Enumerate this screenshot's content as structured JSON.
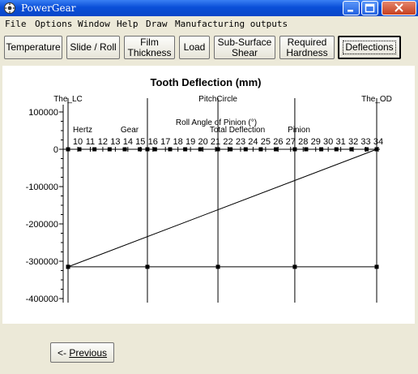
{
  "window": {
    "title": "PowerGear"
  },
  "menu": [
    "File",
    "Options",
    "Window",
    "Help",
    "Draw",
    "Manufacturing outputs"
  ],
  "toolbar": {
    "buttons": [
      {
        "label": "Temperature"
      },
      {
        "label": "Slide / Roll"
      },
      {
        "label": "Film\nThickness"
      },
      {
        "label": "Load"
      },
      {
        "label": "Sub-Surface\nShear"
      },
      {
        "label": "Required\nHardness"
      },
      {
        "label": "Deflections",
        "active": true
      }
    ]
  },
  "chart_data": {
    "type": "line",
    "title": "Tooth Deflection (mm)",
    "xlabel": "Roll Angle of Pinion (°)",
    "ylabel": "",
    "x_ticks": [
      10,
      11,
      12,
      13,
      14,
      15,
      16,
      17,
      18,
      19,
      20,
      21,
      22,
      23,
      24,
      25,
      26,
      27,
      28,
      29,
      30,
      31,
      32,
      33,
      34
    ],
    "y_ticks": [
      100000,
      0,
      -100000,
      -200000,
      -300000,
      -400000
    ],
    "ylim": [
      -400000,
      100000
    ],
    "xlim": [
      9.5,
      34
    ],
    "markers": [
      {
        "label": "The_LC",
        "x": 9.5
      },
      {
        "label": "PitchCircle",
        "x": 21.4
      },
      {
        "label": "The_OD",
        "x": 34
      }
    ],
    "vertical_lines_x": [
      9.5,
      15.8,
      21.4,
      27.5,
      34
    ],
    "legend": [
      "Hertz",
      "Gear",
      "Total Deflection",
      "Pinion"
    ],
    "series": [
      {
        "name": "Hertz",
        "x": [
          9.5,
          10.4,
          11.6,
          12.8,
          14.0,
          15.2,
          15.8,
          16.4,
          17.6,
          18.8,
          20.0,
          21.4,
          22.4,
          23.6,
          24.8,
          26.0,
          27.5,
          28.4,
          29.6,
          30.8,
          32.0,
          33.2,
          34
        ],
        "y": [
          0,
          0,
          0,
          0,
          0,
          0,
          0,
          0,
          0,
          0,
          0,
          0,
          0,
          0,
          0,
          0,
          0,
          0,
          0,
          0,
          0,
          0,
          0
        ]
      },
      {
        "name": "Total Deflection",
        "x": [
          9.5,
          34
        ],
        "y": [
          -315000,
          0
        ]
      },
      {
        "name": "Pinion",
        "x": [
          9.5,
          15.8,
          21.4,
          27.5,
          34
        ],
        "y": [
          -315000,
          -315000,
          -315000,
          -315000,
          -315000
        ]
      }
    ]
  },
  "footer": {
    "prev_prefix": "<- ",
    "prev_label": "Previous"
  }
}
